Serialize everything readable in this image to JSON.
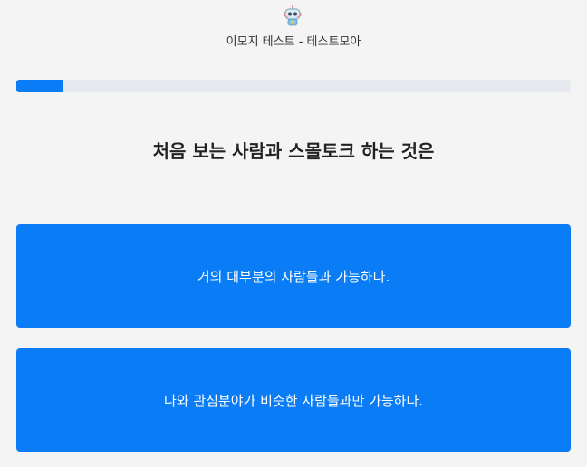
{
  "header": {
    "logo_icon": "robot-mascot-icon",
    "site_title": "이모지 테스트 - 테스트모아"
  },
  "progress": {
    "fraction": 0.083,
    "fill_color": "#0a7cf5",
    "track_color": "#e6e9ed"
  },
  "question": {
    "text": "처음 보는 사람과 스몰토크 하는 것은"
  },
  "answers": [
    {
      "label": "거의 대부분의 사람들과 가능하다."
    },
    {
      "label": "나와 관심분야가 비슷한 사람들과만 가능하다."
    }
  ],
  "colors": {
    "accent": "#0a7cf5",
    "background": "#f4f4f5"
  }
}
